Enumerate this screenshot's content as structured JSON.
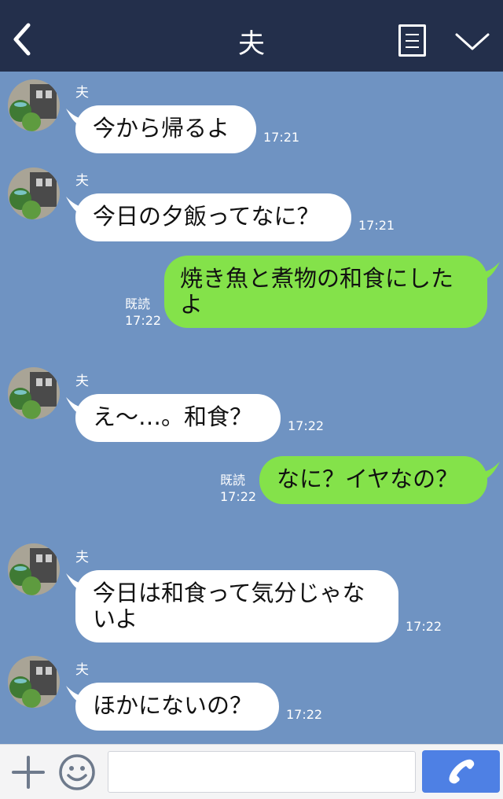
{
  "header": {
    "title": "夫",
    "back_icon": "chevron-left-icon",
    "menu_icon": "menu-icon",
    "collapse_icon": "chevron-down-icon"
  },
  "messages": [
    {
      "side": "in",
      "sender": "夫",
      "text": "今から帰るよ",
      "time": "17:21"
    },
    {
      "side": "in",
      "sender": "夫",
      "text": "今日の夕飯ってなに？",
      "time": "17:21"
    },
    {
      "side": "out",
      "status": "既読",
      "text": "焼き魚と煮物の和食にしたよ",
      "time": "17:22"
    },
    {
      "side": "in",
      "sender": "夫",
      "text": "え〜…。和食？",
      "time": "17:22"
    },
    {
      "side": "out",
      "status": "既読",
      "text": "なに？イヤなの？",
      "time": "17:22"
    },
    {
      "side": "in",
      "sender": "夫",
      "text": "今日は和食って気分じゃないよ",
      "time": "17:22"
    },
    {
      "side": "in",
      "sender": "夫",
      "text": "ほかにないの？",
      "time": "17:22"
    }
  ],
  "footer": {
    "input_placeholder": "",
    "plus_icon": "plus-icon",
    "emoji_icon": "emoji-icon",
    "call_icon": "phone-icon"
  },
  "colors": {
    "header_bg": "#232f4b",
    "chat_bg": "#6f93c2",
    "outgoing_bubble": "#84e24a",
    "incoming_bubble": "#ffffff",
    "call_button": "#4e80e4"
  }
}
